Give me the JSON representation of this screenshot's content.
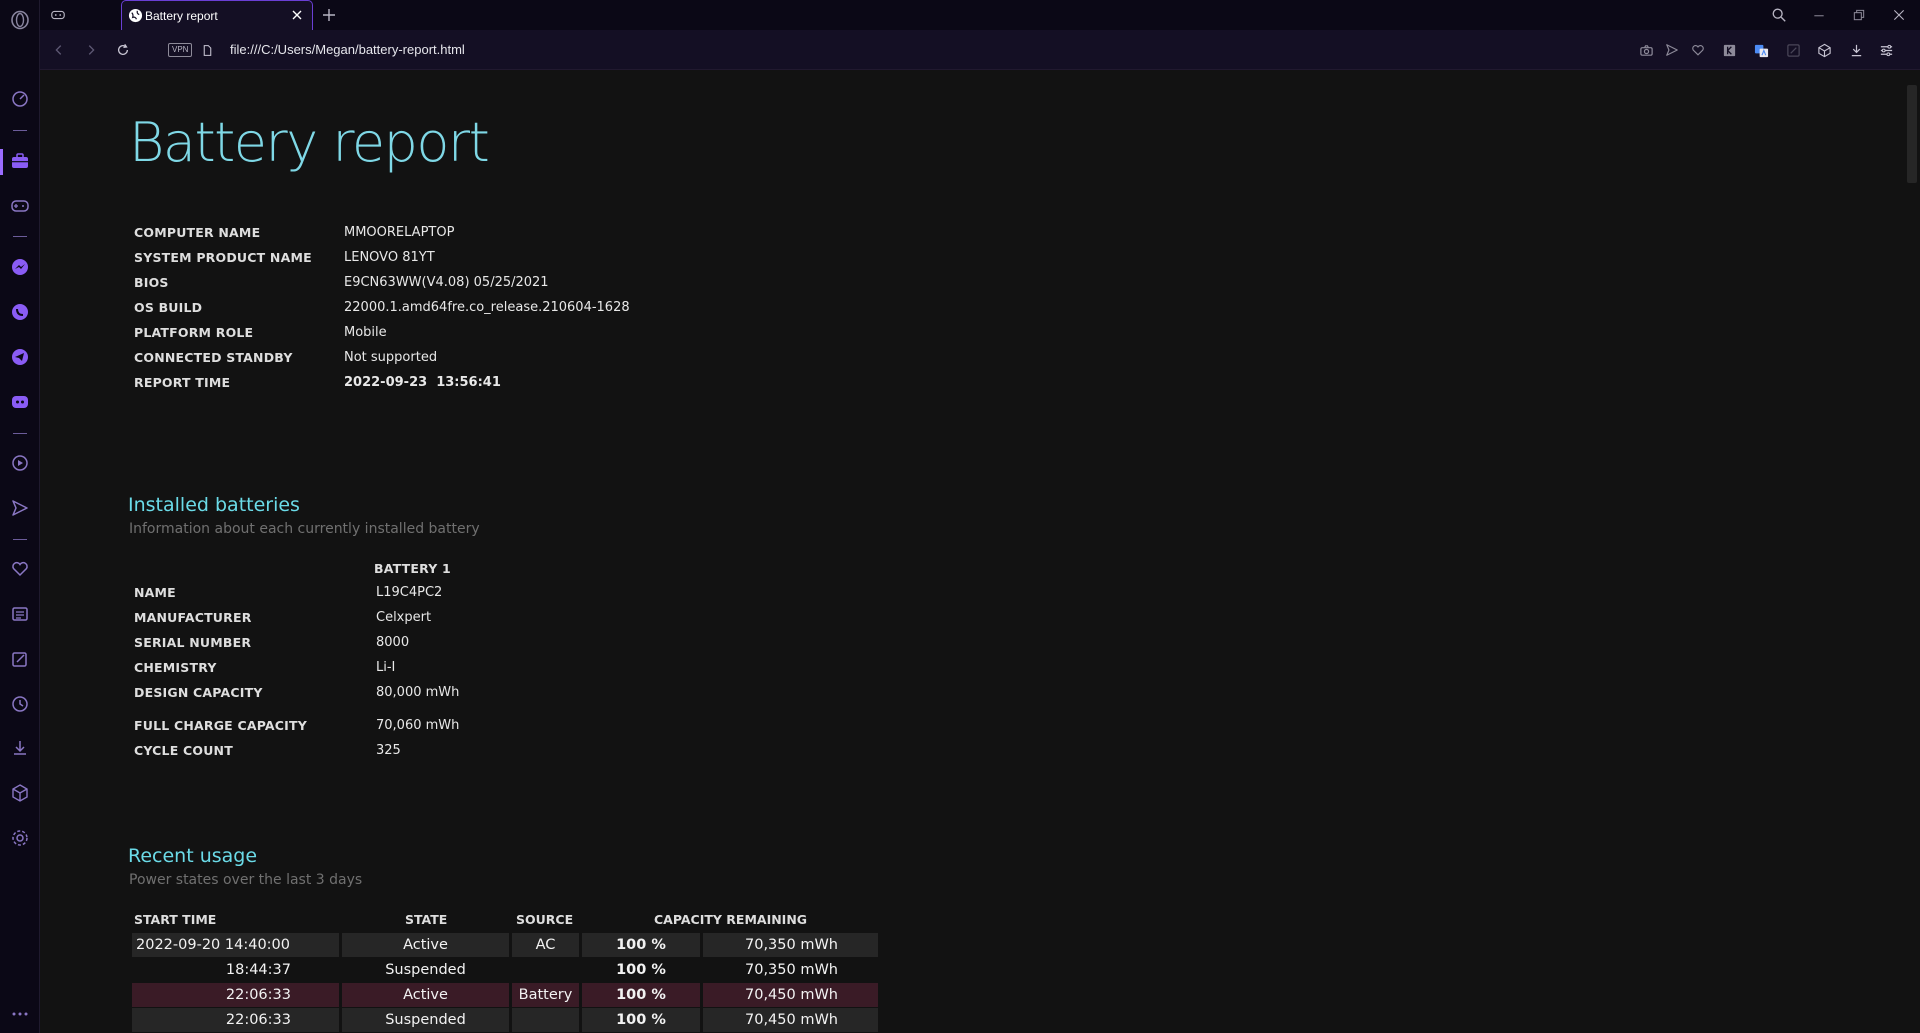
{
  "browser": {
    "tab_title": "Battery report",
    "url": "file:///C:/Users/Megan/battery-report.html",
    "vpn_label": "VPN"
  },
  "sidebar": {
    "items": [
      "speed-dial",
      "workspaces",
      "gx-corner",
      "messenger",
      "whatsapp",
      "telegram",
      "discord",
      "player",
      "flow",
      "bookmarks",
      "news",
      "pinboard",
      "history",
      "downloads",
      "extensions",
      "settings",
      "more"
    ]
  },
  "report": {
    "title": "Battery report",
    "system_info": [
      {
        "label": "COMPUTER NAME",
        "value": "MMOORELAPTOP"
      },
      {
        "label": "SYSTEM PRODUCT NAME",
        "value": "LENOVO 81YT"
      },
      {
        "label": "BIOS",
        "value": "E9CN63WW(V4.08) 05/25/2021"
      },
      {
        "label": "OS BUILD",
        "value": "22000.1.amd64fre.co_release.210604-1628"
      },
      {
        "label": "PLATFORM ROLE",
        "value": "Mobile"
      },
      {
        "label": "CONNECTED STANDBY",
        "value": "Not supported"
      },
      {
        "label": "REPORT TIME",
        "value": "2022-09-23  13:56:41"
      }
    ],
    "installed_batteries": {
      "heading": "Installed batteries",
      "subtitle": "Information about each currently installed battery",
      "column_header": "BATTERY 1",
      "rows": [
        {
          "label": "NAME",
          "value": "L19C4PC2"
        },
        {
          "label": "MANUFACTURER",
          "value": "Celxpert"
        },
        {
          "label": "SERIAL NUMBER",
          "value": "8000"
        },
        {
          "label": "CHEMISTRY",
          "value": "Li-I"
        },
        {
          "label": "DESIGN CAPACITY",
          "value": "80,000 mWh"
        },
        {
          "label": "FULL CHARGE CAPACITY",
          "value": "70,060 mWh"
        },
        {
          "label": "CYCLE COUNT",
          "value": "325"
        }
      ]
    },
    "recent_usage": {
      "heading": "Recent usage",
      "subtitle": "Power states over the last 3 days",
      "columns": [
        "START TIME",
        "STATE",
        "SOURCE",
        "CAPACITY REMAINING"
      ],
      "rows": [
        {
          "start_time": "2022-09-20  14:40:00",
          "state": "Active",
          "source": "AC",
          "percent": "100 %",
          "energy": "70,350 mWh"
        },
        {
          "start_time": "18:44:37",
          "state": "Suspended",
          "source": "",
          "percent": "100 %",
          "energy": "70,350 mWh"
        },
        {
          "start_time": "22:06:33",
          "state": "Active",
          "source": "Battery",
          "percent": "100 %",
          "energy": "70,450 mWh"
        },
        {
          "start_time": "22:06:33",
          "state": "Suspended",
          "source": "",
          "percent": "100 %",
          "energy": "70,450 mWh"
        }
      ]
    }
  }
}
